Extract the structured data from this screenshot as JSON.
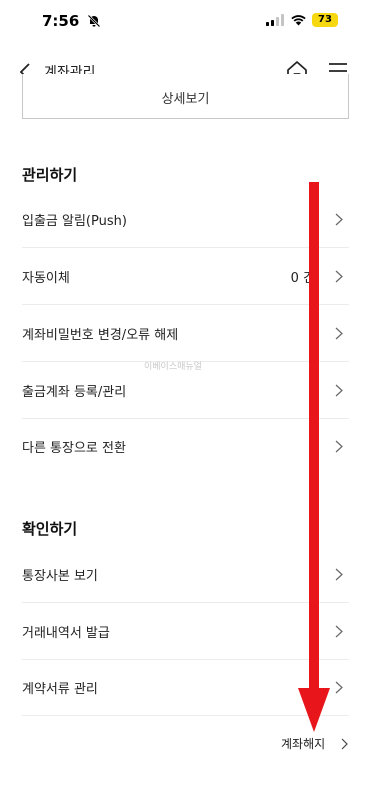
{
  "status_bar": {
    "time": "7:56",
    "battery": "73"
  },
  "header": {
    "title": "계좌관리"
  },
  "detail_button": {
    "label": "상세보기"
  },
  "manage_section": {
    "title": "관리하기",
    "items": [
      {
        "label": "입출금 알림(Push)"
      },
      {
        "label": "자동이체",
        "count": "0 건"
      },
      {
        "label": "계좌비밀번호 변경/오류 해제"
      },
      {
        "label": "출금계좌 등록/관리"
      },
      {
        "label": "다른 통장으로 전환"
      }
    ]
  },
  "confirm_section": {
    "title": "확인하기",
    "items": [
      {
        "label": "통장사본 보기"
      },
      {
        "label": "거래내역서 발급"
      },
      {
        "label": "계약서류 관리"
      }
    ]
  },
  "footer": {
    "close_account_label": "계좌해지"
  },
  "watermark": "이베이스매뉴얼",
  "colors": {
    "accent_red": "#e8161b",
    "battery": "#f5d80f",
    "divider": "#ececec"
  },
  "icons": [
    "bell-off-icon",
    "signal-icon",
    "wifi-icon",
    "back-icon",
    "home-icon",
    "hamburger-menu-icon",
    "chevron-right-icon"
  ]
}
